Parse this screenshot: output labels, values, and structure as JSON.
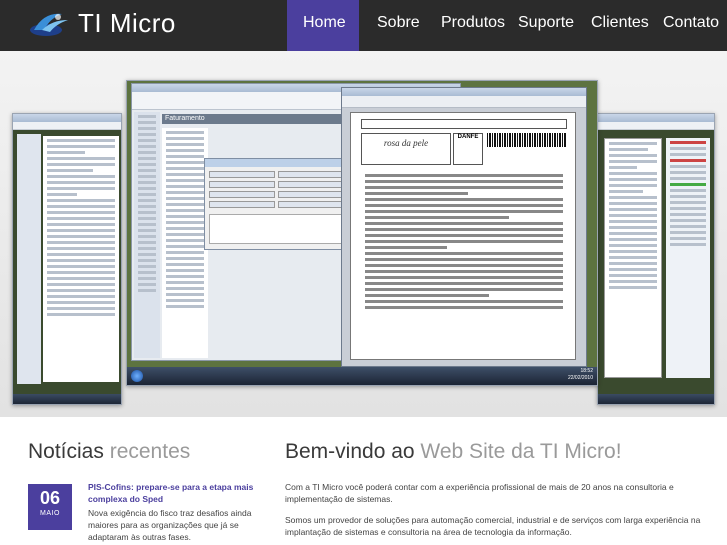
{
  "header": {
    "brand": "TI Micro",
    "nav": [
      {
        "label": "Home",
        "active": true
      },
      {
        "label": "Sobre"
      },
      {
        "label": "Produtos"
      },
      {
        "label": "Suporte"
      },
      {
        "label": "Clientes"
      },
      {
        "label": "Contato"
      }
    ]
  },
  "hero": {
    "main_window_title": "Faturamento",
    "doc_brand": "rosa da pele",
    "doc_label": "DANFE",
    "clock_time": "18:52",
    "clock_date": "22/02/2010"
  },
  "news": {
    "title_main": "Notícias",
    "title_light": "recentes",
    "items": [
      {
        "day": "06",
        "month": "MAIO",
        "headline": "PIS-Cofins: prepare-se para a etapa mais complexa do Sped",
        "body": "Nova exigência do fisco traz desafios ainda maiores para as organizações que já se adaptaram às outras fases."
      }
    ]
  },
  "welcome": {
    "title_main": "Bem-vindo ao",
    "title_accent": "Web Site da TI Micro!",
    "p1": "Com a TI Micro você poderá contar com a experiência profissional de mais de 20 anos na consultoria e implementação de sistemas.",
    "p2": "Somos um provedor de soluções para automação comercial, industrial e de serviços com larga experiência na implantação de sistemas e consultoria na área de tecnologia da informação."
  },
  "colors": {
    "header_bg": "#2b2b2b",
    "accent": "#4b3f9e"
  }
}
